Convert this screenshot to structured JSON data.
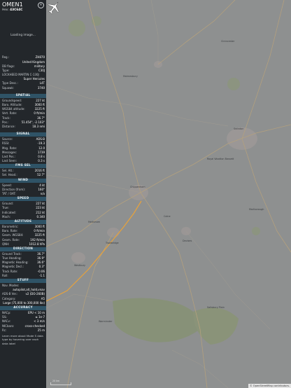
{
  "aircraft": {
    "callsign": "OMEN1",
    "hex_label": "Hex:",
    "hex": "43C64C",
    "close": "×"
  },
  "photo": {
    "loading": "Loading image..."
  },
  "basic": [
    {
      "k": "Reg.:",
      "v": "ZH870"
    },
    {
      "k": "",
      "v": "United Kingdom"
    },
    {
      "k": "DB flags:",
      "v": "military"
    },
    {
      "k": "Type:",
      "v": "C30J"
    },
    {
      "k": "LOCKHEED MARTIN C-130J",
      "v": ""
    },
    {
      "k": "",
      "v": "Super Hercules"
    },
    {
      "k": "Type Desc.:",
      "v": "L4T"
    },
    {
      "k": "Squawk:",
      "v": "3740"
    }
  ],
  "spatial": {
    "title": "SPATIAL",
    "rows": [
      {
        "k": "Groundspeed:",
        "v": "227 kt"
      },
      {
        "k": "Baro. Altitude:",
        "v": "3000 ft"
      },
      {
        "k": "WGS84 altitude:",
        "v": "3225 ft"
      },
      {
        "k": "Vert. Rate:",
        "v": "0 ft/min"
      },
      {
        "k": "Track:",
        "v": "36.7°"
      },
      {
        "k": "Pos.:",
        "v": "51.454°, -2.103°"
      },
      {
        "k": "Distance:",
        "v": "18.3 nmi"
      }
    ]
  },
  "signal": {
    "title": "SIGNAL",
    "rows": [
      {
        "k": "Source:",
        "v": "ADS-B"
      },
      {
        "k": "RSSI:",
        "v": "-19.3"
      },
      {
        "k": "Msg. Rate:",
        "v": "12.0"
      },
      {
        "k": "Messages:",
        "v": "1739"
      },
      {
        "k": "Last Pos.:",
        "v": "0.8 s"
      },
      {
        "k": "Last Seen:",
        "v": "0.3 s"
      }
    ]
  },
  "fms": {
    "title": "FMS SEL",
    "rows": [
      {
        "k": "Sel. Alt.:",
        "v": "2016 ft"
      },
      {
        "k": "Sel. Head.:",
        "v": "52.7°"
      }
    ]
  },
  "wind": {
    "title": "WIND",
    "rows": [
      {
        "k": "Speed:",
        "v": "4 kt"
      },
      {
        "k": "Direction (from):",
        "v": "160°"
      },
      {
        "k": "TAT / OAT:",
        "v": "n/a"
      }
    ]
  },
  "speed": {
    "title": "SPEED",
    "rows": [
      {
        "k": "Ground:",
        "v": "227 kt"
      },
      {
        "k": "True:",
        "v": "223 kt"
      },
      {
        "k": "Indicated:",
        "v": "212 kt"
      },
      {
        "k": "Mach:",
        "v": "0.340"
      }
    ]
  },
  "altitude": {
    "title": "ALTITUDE",
    "rows": [
      {
        "k": "Barometric:",
        "v": "3000 ft"
      },
      {
        "k": "Baro. Rate:",
        "v": "0 ft/min"
      },
      {
        "k": "Geom. WGS84:",
        "v": "3225 ft"
      },
      {
        "k": "Geom. Rate:",
        "v": "192 ft/min"
      },
      {
        "k": "QNH:",
        "v": "1012.8 hPa"
      }
    ]
  },
  "direction": {
    "title": "DIRECTION",
    "rows": [
      {
        "k": "Ground Track:",
        "v": "36.7°"
      },
      {
        "k": "True Heading:",
        "v": "36.9°"
      },
      {
        "k": "Magnetic Heading:",
        "v": "36.6°"
      },
      {
        "k": "Magnetic Decl.:",
        "v": "0.3°"
      },
      {
        "k": "Track Rate:",
        "v": "-0.06"
      },
      {
        "k": "Roll:",
        "v": "-1.1"
      }
    ]
  },
  "stuff": {
    "title": "STUFF",
    "nav_modes_label": "Nav. Modes:",
    "nav_modes_value": "autopilot,alt_hold,vnav",
    "rows": [
      {
        "k": "ADS-B Ver.:",
        "v": "v2 (DO-260B)"
      },
      {
        "k": "Category:",
        "v": "A5"
      }
    ],
    "category_desc": "Large (75,000 to 300,000 lbs)"
  },
  "accuracy": {
    "title": "ACCURACY",
    "rows": [
      {
        "k": "NACp:",
        "v": "EPU < 10 m"
      },
      {
        "k": "SIL:",
        "v": "≤ 1e-7"
      },
      {
        "k": "NACv:",
        "v": "< 3 m/s"
      },
      {
        "k": "NICbaro:",
        "v": "cross-checked"
      },
      {
        "k": "Rc:",
        "v": "25 m"
      }
    ]
  },
  "footer": {
    "text": "Learn more about Mode S data type by hovering over each data label"
  },
  "map": {
    "attribution": "© OpenStreetMap contributors.",
    "scale": "20 km",
    "places": [
      "Swindon",
      "Royal Wootton Bassett",
      "Chippenham",
      "Calne",
      "Devizes",
      "Marlborough",
      "Salisbury Plain",
      "Westbury",
      "Warminster",
      "Trowbridge",
      "Cirencester",
      "Malmesbury",
      "Melksham"
    ],
    "colors": {
      "track": "#e8a23a",
      "aircraft": "#ffffff",
      "map_bg": "#8f9191"
    }
  }
}
